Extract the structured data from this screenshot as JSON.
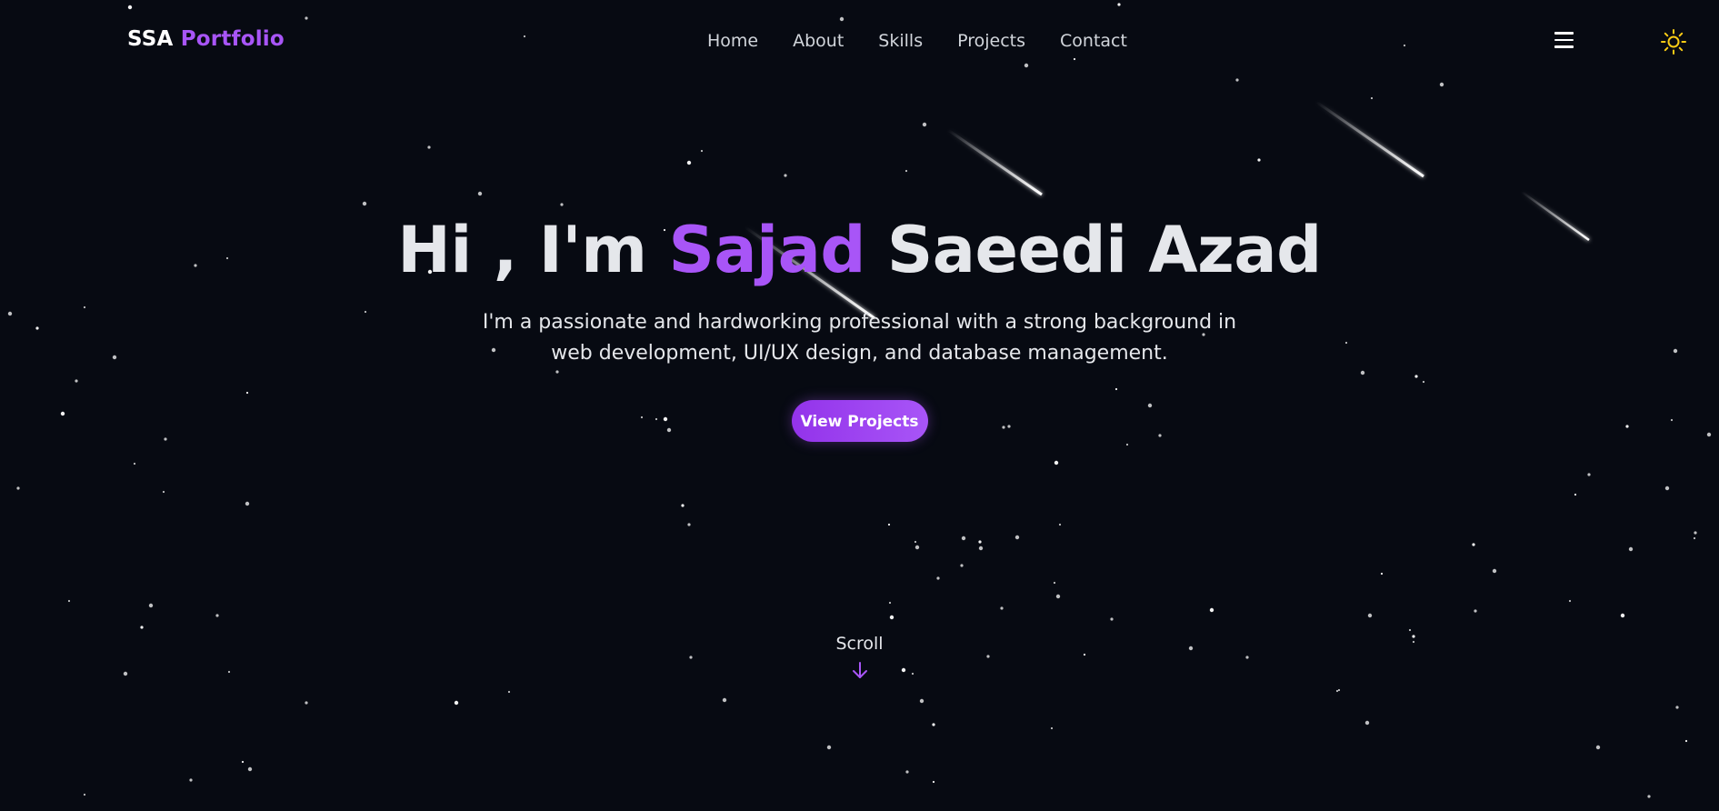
{
  "brand": {
    "part1": "SSA",
    "part2": "Portfolio"
  },
  "nav": {
    "items": [
      {
        "label": "Home"
      },
      {
        "label": "About"
      },
      {
        "label": "Skills"
      },
      {
        "label": "Projects"
      },
      {
        "label": "Contact"
      }
    ],
    "menu_icon": "hamburger-menu-icon",
    "theme_icon": "sun-icon"
  },
  "hero": {
    "greeting": "Hi , I'm",
    "first_name": "Sajad",
    "last_name": "Saeedi Azad",
    "subtitle": "I'm a passionate and hardworking professional with a strong background in web development, UI/UX design, and database management.",
    "cta_label": "View Projects"
  },
  "scroll": {
    "label": "Scroll",
    "icon": "arrow-down-icon"
  },
  "colors": {
    "background": "#070a12",
    "accent": "#a855f7",
    "text": "#e5e7eb",
    "sun": "#facc15"
  }
}
